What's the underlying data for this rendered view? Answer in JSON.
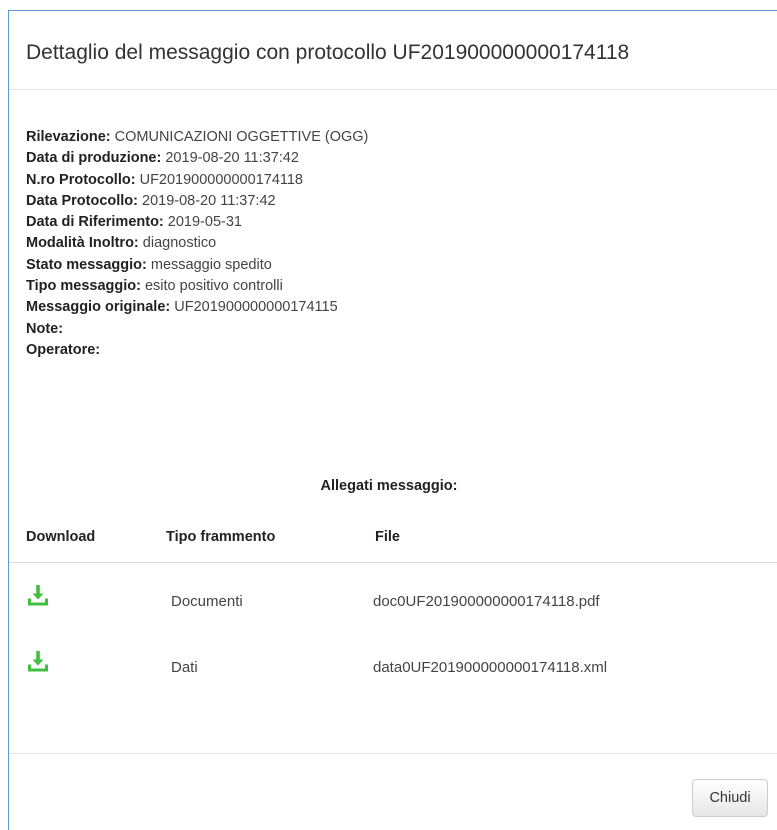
{
  "modal": {
    "title": "Dettaglio del messaggio con protocollo UF201900000000174118",
    "details": [
      {
        "label": "Rilevazione:",
        "value": " COMUNICAZIONI OGGETTIVE (OGG)"
      },
      {
        "label": "Data di produzione:",
        "value": " 2019-08-20 11:37:42"
      },
      {
        "label": "N.ro Protocollo:",
        "value": " UF201900000000174118"
      },
      {
        "label": "Data Protocollo:",
        "value": " 2019-08-20 11:37:42"
      },
      {
        "label": "Data di Riferimento:",
        "value": " 2019-05-31"
      },
      {
        "label": "Modalità Inoltro:",
        "value": " diagnostico"
      },
      {
        "label": "Stato messaggio:",
        "value": " messaggio spedito"
      },
      {
        "label": "Tipo messaggio:",
        "value": " esito positivo controlli"
      },
      {
        "label": "Messaggio originale:",
        "value": " UF201900000000174115"
      },
      {
        "label": "Note:",
        "value": ""
      },
      {
        "label": "Operatore:",
        "value": ""
      }
    ],
    "attachments": {
      "title": "Allegati messaggio:",
      "headers": {
        "download": "Download",
        "tipo": "Tipo frammento",
        "file": "File"
      },
      "rows": [
        {
          "icon": "download-icon",
          "tipo": "Documenti",
          "file": "doc0UF201900000000174118.pdf"
        },
        {
          "icon": "download-icon",
          "tipo": "Dati",
          "file": "data0UF201900000000174118.xml"
        }
      ]
    },
    "close_label": "Chiudi"
  },
  "colors": {
    "border_accent": "#5b9bd5",
    "download_icon": "#3fbf3f",
    "text": "#333333"
  }
}
